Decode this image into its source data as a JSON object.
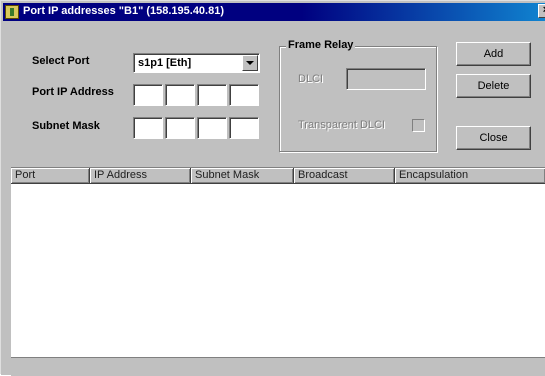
{
  "window": {
    "title": "Port IP addresses  \"B1\" (158.195.40.81)",
    "close_glyph": "×"
  },
  "form": {
    "select_port_label": "Select Port",
    "select_port_value": "s1p1 [Eth]",
    "port_ip_label": "Port IP Address",
    "subnet_mask_label": "Subnet Mask",
    "port_ip_octets": [
      "",
      "",
      "",
      ""
    ],
    "subnet_mask_octets": [
      "",
      "",
      "",
      ""
    ]
  },
  "frame_relay": {
    "legend": "Frame Relay",
    "dlci_label": "DLCI",
    "dlci_value": "",
    "transparent_label": "Transparent DLCI"
  },
  "buttons": {
    "add": "Add",
    "delete": "Delete",
    "close": "Close"
  },
  "table": {
    "columns": [
      "Port",
      "IP Address",
      "Subnet Mask",
      "Broadcast",
      "Encapsulation"
    ],
    "rows": []
  }
}
